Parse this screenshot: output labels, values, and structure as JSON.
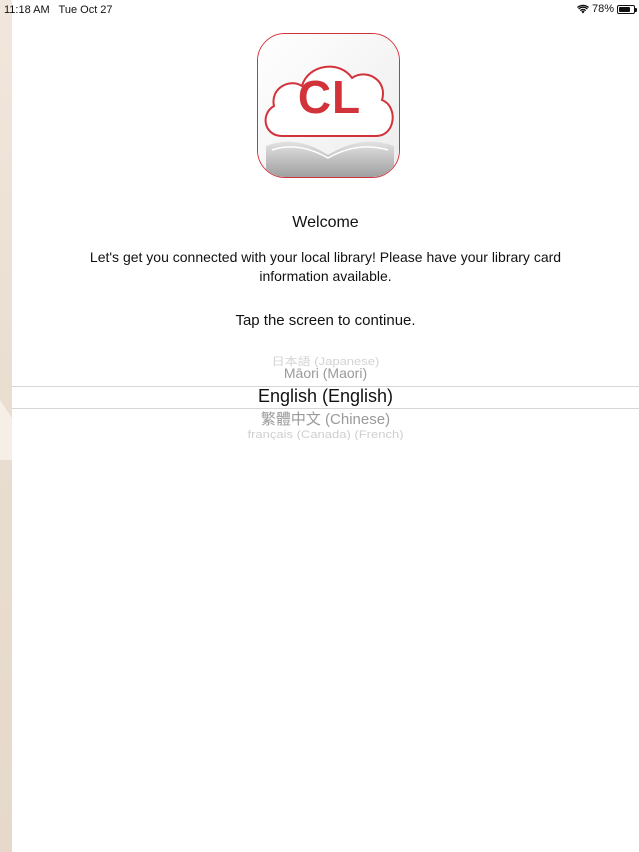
{
  "status": {
    "time": "11:18 AM",
    "date": "Tue Oct 27",
    "battery": "78%",
    "battery_level": 0.78,
    "wifi_icon": "wifi-icon",
    "battery_icon": "battery-icon"
  },
  "logo": {
    "text": "CL",
    "brand_color": "#d2323a"
  },
  "welcome": {
    "title": "Welcome",
    "body": "Let's get you connected with your local library! Please have your library card information available.",
    "tap": "Tap the screen to continue."
  },
  "languages": {
    "items": [
      "日本語 (Japanese)",
      "Māori (Maori)",
      "English (English)",
      "繁體中文 (Chinese)",
      "français (Canada) (French)"
    ],
    "selected": "English (English)"
  }
}
